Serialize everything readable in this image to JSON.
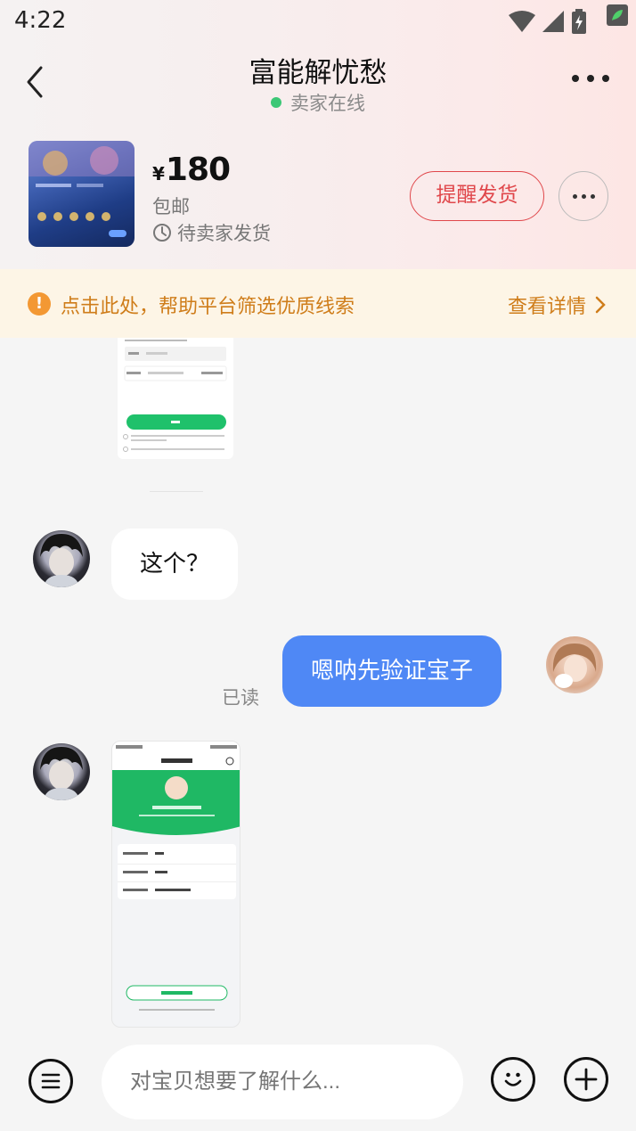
{
  "status_bar": {
    "time": "4:22"
  },
  "header": {
    "title": "富能解忧愁",
    "subtitle": "卖家在线",
    "online_color": "#3cc776"
  },
  "product": {
    "currency": "¥",
    "price": "180",
    "shipping": "包邮",
    "status": "待卖家发货",
    "remind_button": "提醒发货",
    "accent": "#e0474b"
  },
  "notice": {
    "icon": "!",
    "text": "点击此处，帮助平台筛选优质线索",
    "link": "查看详情",
    "color": "#cf7d1a"
  },
  "messages": [
    {
      "from": "seller",
      "type": "image",
      "content": "verification-form-screenshot"
    },
    {
      "from": "seller",
      "type": "text",
      "text": "这个？"
    },
    {
      "from": "buyer",
      "type": "text",
      "text": "嗯呐先验证宝子",
      "read_status": "已读"
    },
    {
      "from": "seller",
      "type": "image",
      "content": "identity-page-screenshot"
    }
  ],
  "input_bar": {
    "placeholder": "对宝贝想要了解什么..."
  },
  "colors": {
    "bubble_self": "#4f88f5",
    "bubble_other": "#ffffff",
    "background": "#f5f5f5"
  }
}
